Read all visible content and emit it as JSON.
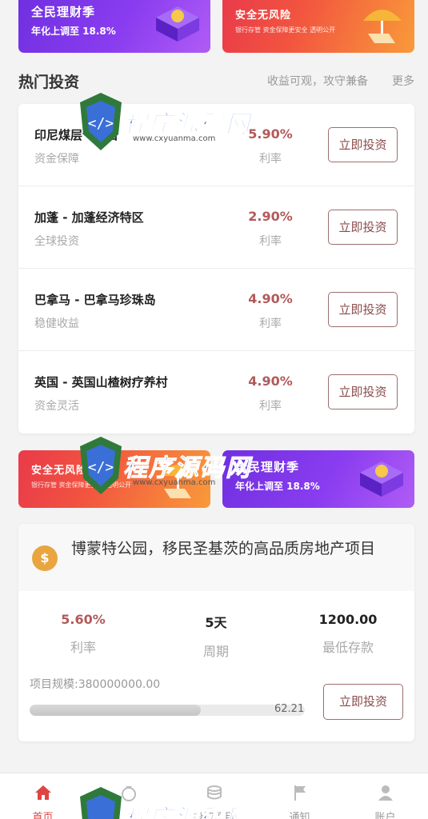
{
  "banners": {
    "licai": {
      "title": "全民理财季",
      "subtitle": "年化上调至 18.8%"
    },
    "anquan": {
      "title": "安全无风险",
      "subtitle": "银行存管 资金保障更安全 透明公开"
    }
  },
  "section": {
    "title": "热门投资",
    "subtitle": "收益可观，攻守兼备",
    "more": "更多"
  },
  "rate_label": "利率",
  "invest_button": "立即投资",
  "invest_list": [
    {
      "name": "印尼煤层气项目",
      "tag": "资金保障",
      "rate": "5.90%"
    },
    {
      "name": "加蓬 - 加蓬经济特区",
      "tag": "全球投资",
      "rate": "2.90%"
    },
    {
      "name": "巴拿马 - 巴拿马珍珠岛",
      "tag": "稳健收益",
      "rate": "4.90%"
    },
    {
      "name": "英国 - 英国山楂树疗养村",
      "tag": "资金灵活",
      "rate": "4.90%"
    }
  ],
  "project": {
    "icon": "$",
    "title": "博蒙特公园，移民圣基茨的高品质房地产项目",
    "stats": [
      {
        "value": "5.60%",
        "label": "利率"
      },
      {
        "value": "5天",
        "label": "周期"
      },
      {
        "value": "1200.00",
        "label": "最低存款"
      }
    ],
    "scale": "项目规模:380000000.00",
    "progress": 62.21,
    "progress_text": "62.21",
    "button": "立即投资"
  },
  "tabbar": [
    {
      "label": "首页",
      "icon": "home-icon",
      "active": true
    },
    {
      "label": "",
      "icon": "money-bag-icon",
      "active": false
    },
    {
      "label": "投资项目",
      "icon": "coins-icon",
      "active": false
    },
    {
      "label": "通知",
      "icon": "flag-icon",
      "active": false
    },
    {
      "label": "账户",
      "icon": "user-icon",
      "active": false
    }
  ],
  "watermark": {
    "text": "程序源码网",
    "url": "www.cxyuanma.com"
  },
  "colors": {
    "accent": "#b25a5a",
    "button_border": "#9b6e6e",
    "active_tab": "#dd4444",
    "banner_purple": "#7b35e8",
    "banner_orange": "#f0503f"
  }
}
